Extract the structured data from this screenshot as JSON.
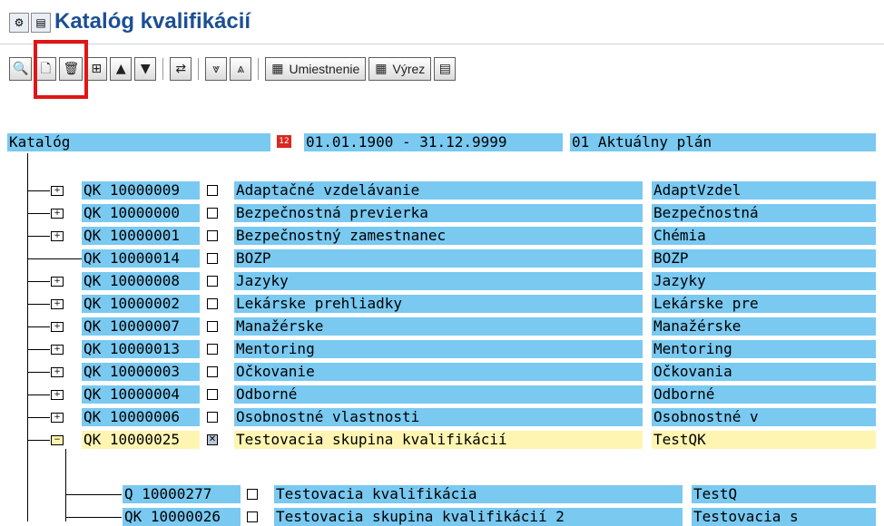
{
  "window": {
    "title": "Katalóg kvalifikácií"
  },
  "toolbar": {
    "buttons": [
      {
        "name": "find-icon",
        "glyph": "🔍"
      },
      {
        "name": "create-icon",
        "glyph": "🗋"
      },
      {
        "name": "delete-icon",
        "glyph": "🗑"
      },
      {
        "name": "hierarchy-icon",
        "glyph": "⊞"
      },
      {
        "name": "move-up-icon",
        "glyph": "▲"
      },
      {
        "name": "move-down-icon",
        "glyph": "▼"
      },
      {
        "name": "transfer-icon",
        "glyph": "⇄"
      },
      {
        "name": "expand-icon",
        "glyph": "⩔"
      },
      {
        "name": "collapse-icon",
        "glyph": "⩓"
      }
    ],
    "placement_label": "Umiestnenie",
    "cutout_label": "Výrez",
    "settings_glyph": "▤"
  },
  "header": {
    "catalog_label": "Katalóg",
    "calendar_icon_text": "12",
    "date_range": "01.01.1900 - 31.12.9999",
    "plan": "01 Aktuálny plán"
  },
  "items": [
    {
      "code": "QK 10000009",
      "checked": false,
      "name": "Adaptačné vzdelávanie",
      "short": "AdaptVzdel",
      "expander": "+",
      "selected": false
    },
    {
      "code": "QK 10000000",
      "checked": false,
      "name": "Bezpečnostná previerka",
      "short": "Bezpečnostná",
      "expander": "+",
      "selected": false
    },
    {
      "code": "QK 10000001",
      "checked": false,
      "name": "Bezpečnostný zamestnanec",
      "short": "Chémia",
      "expander": "+",
      "selected": false
    },
    {
      "code": "QK 10000014",
      "checked": false,
      "name": "BOZP",
      "short": "BOZP",
      "expander": "",
      "selected": false
    },
    {
      "code": "QK 10000008",
      "checked": false,
      "name": "Jazyky",
      "short": "Jazyky",
      "expander": "+",
      "selected": false
    },
    {
      "code": "QK 10000002",
      "checked": false,
      "name": "Lekárske prehliadky",
      "short": "Lekárske pre",
      "expander": "+",
      "selected": false
    },
    {
      "code": "QK 10000007",
      "checked": false,
      "name": "Manažérske",
      "short": "Manažérske",
      "expander": "+",
      "selected": false
    },
    {
      "code": "QK 10000013",
      "checked": false,
      "name": "Mentoring",
      "short": "Mentoring",
      "expander": "+",
      "selected": false
    },
    {
      "code": "QK 10000003",
      "checked": false,
      "name": "Očkovanie",
      "short": "Očkovania",
      "expander": "+",
      "selected": false
    },
    {
      "code": "QK 10000004",
      "checked": false,
      "name": "Odborné",
      "short": "Odborné",
      "expander": "+",
      "selected": false
    },
    {
      "code": "QK 10000006",
      "checked": false,
      "name": "Osobnostné vlastnosti",
      "short": "Osobnostné v",
      "expander": "+",
      "selected": false
    },
    {
      "code": "QK 10000025",
      "checked": true,
      "name": "Testovacia skupina kvalifikácií",
      "short": "TestQK",
      "expander": "−",
      "selected": true
    }
  ],
  "children": [
    {
      "code": "Q  10000277",
      "checked": false,
      "name": "Testovacia kvalifikácia",
      "short": "TestQ"
    },
    {
      "code": "QK 10000026",
      "checked": false,
      "name": "Testovacia skupina kvalifikácií 2",
      "short": "Testovacia s"
    }
  ],
  "colors": {
    "row_blue": "#79c9f1",
    "row_selected": "#fff5b2",
    "title": "#1c4f94",
    "highlight": "#e01515"
  }
}
